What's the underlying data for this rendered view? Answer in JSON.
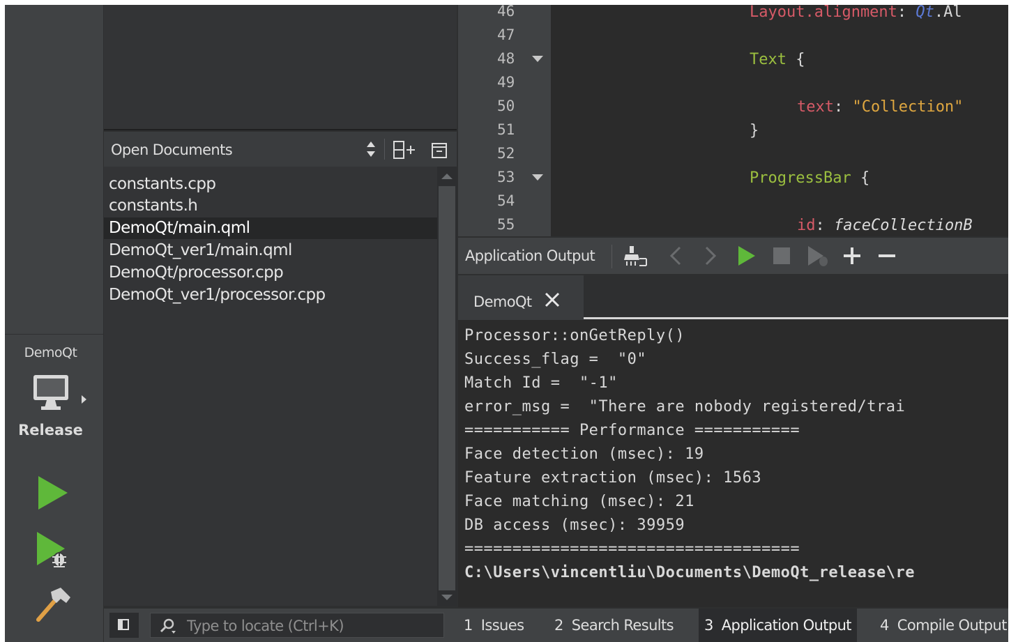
{
  "kit": {
    "project": "DemoQt",
    "build": "Release"
  },
  "open_documents": {
    "title": "Open Documents",
    "items": [
      "constants.cpp",
      "constants.h",
      "DemoQt/main.qml",
      "DemoQt_ver1/main.qml",
      "DemoQt/processor.cpp",
      "DemoQt_ver1/processor.cpp"
    ],
    "selected_index": 2
  },
  "editor": {
    "line_numbers": [
      "46",
      "47",
      "48",
      "49",
      "50",
      "51",
      "52",
      "53",
      "54",
      "55"
    ],
    "folded_lines": [
      "48",
      "53"
    ],
    "code": {
      "l46_prop": "Layout.alignment",
      "l46_colon": ":",
      "l46_qt": "Qt",
      "l46_rest": ".Al",
      "l48_type": "Text",
      "l48_brace": "{",
      "l50_prop": "text",
      "l50_colon": ":",
      "l50_str": "\"Collection\"",
      "l51_brace": "}",
      "l53_type": "ProgressBar",
      "l53_brace": "{",
      "l55_prop": "id",
      "l55_colon": ":",
      "l55_val": "faceCollectionB"
    }
  },
  "app_output": {
    "title": "Application Output",
    "tab_label": "DemoQt",
    "lines": [
      "Processor::onGetReply()",
      "Success_flag =  \"0\"",
      "Match Id =  \"-1\"",
      "error_msg =  \"There are nobody registered/trai",
      "=========== Performance ===========",
      "Face detection (msec): 19",
      "Feature extraction (msec): 1563",
      "Face matching (msec): 21",
      "DB access (msec): 39959",
      "===================================",
      "C:\\Users\\vincentliu\\Documents\\DemoQt_release\\re"
    ]
  },
  "locator": {
    "placeholder": "Type to locate (Ctrl+K)"
  },
  "output_panes": [
    {
      "num": "1",
      "label": "Issues"
    },
    {
      "num": "2",
      "label": "Search Results"
    },
    {
      "num": "3",
      "label": "Application Output"
    },
    {
      "num": "4",
      "label": "Compile Output"
    }
  ],
  "colors": {
    "run_green": "#5fb83a",
    "keyword_red": "#d65a67",
    "type_green": "#9bbf3f",
    "string_orange": "#dfa740",
    "qt_blue": "#5c7ad6"
  }
}
